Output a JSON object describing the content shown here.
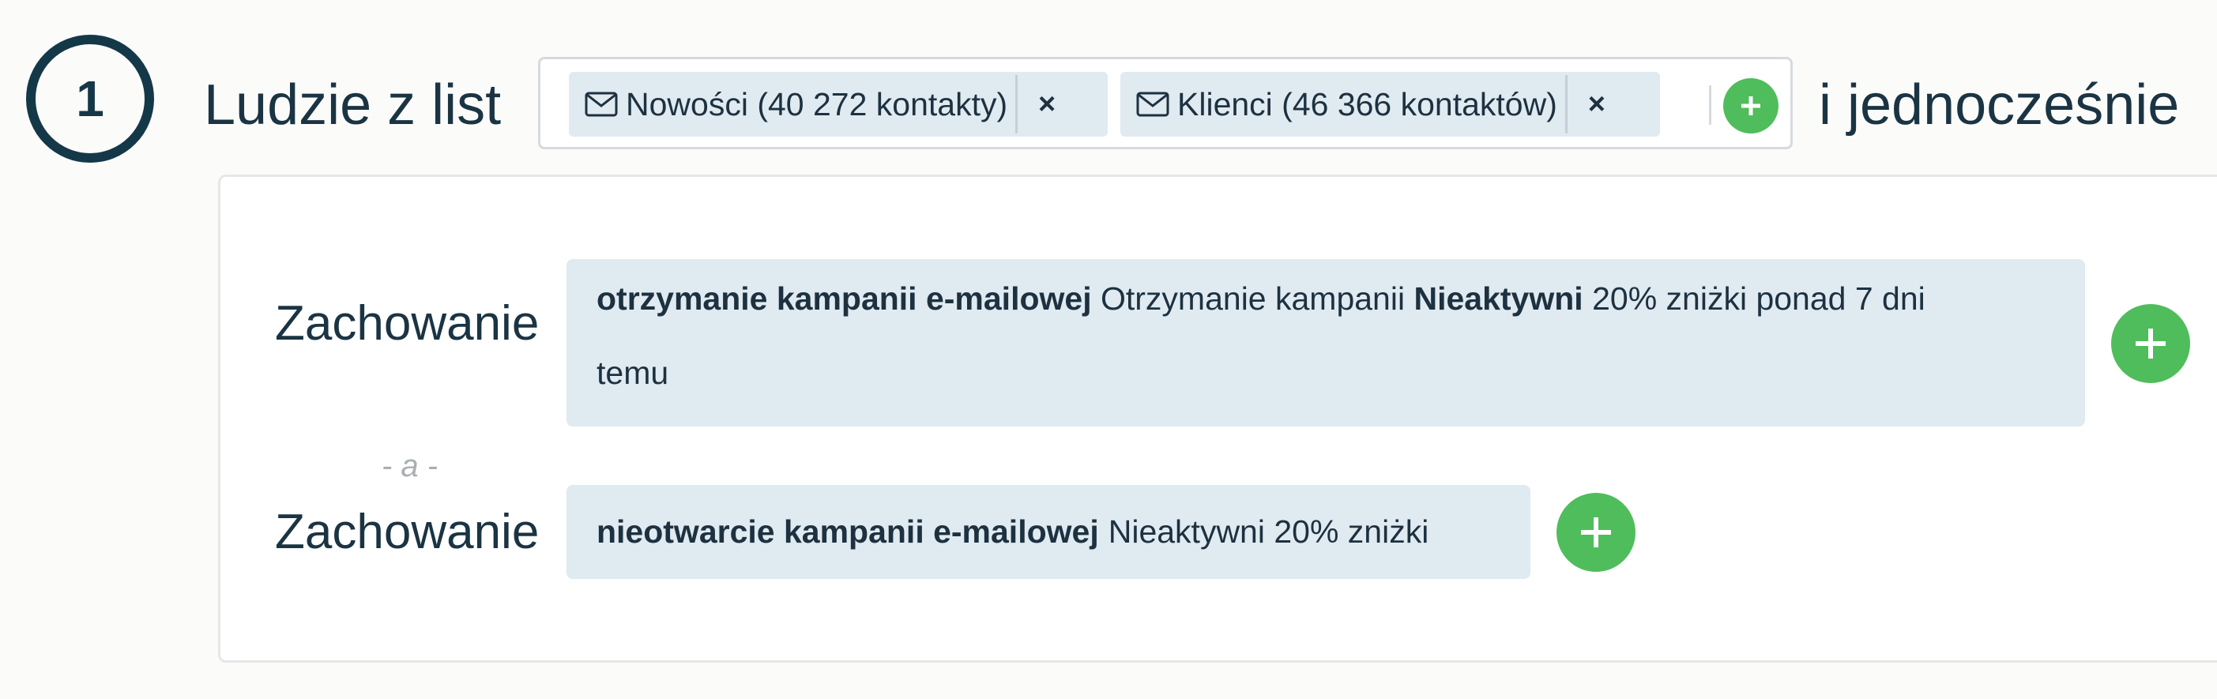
{
  "step": {
    "number": "1",
    "title": "Ludzie z list"
  },
  "lists": {
    "chips": [
      {
        "label": "Nowości (40 272 kontakty)",
        "icon": "envelope-icon",
        "remove": "×"
      },
      {
        "label": "Klienci (46 366 kontaktów)",
        "icon": "envelope-icon",
        "remove": "×"
      }
    ],
    "add_icon": "plus-icon"
  },
  "connector_top": "i jednocześnie",
  "behaviours": {
    "rows": [
      {
        "label": "Zachowanie",
        "condition_bold": "otrzymanie kampanii e-mailowej",
        "condition_text_1": "Otrzymanie kampanii",
        "condition_bold_2": "Nieaktywni",
        "condition_text_2": "20% zniżki ponad 7 dni",
        "condition_text_3": "temu"
      },
      {
        "label": "Zachowanie",
        "condition_bold": "nieotwarcie kampanii e-mailowej",
        "condition_text_1": "Nieaktywni 20% zniżki"
      }
    ],
    "connector": "- a -"
  },
  "colors": {
    "accent_green": "#4fbd5b",
    "circle_border": "#143848",
    "chip_bg": "#e0eaf1"
  }
}
